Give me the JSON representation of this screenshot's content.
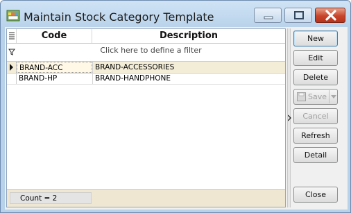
{
  "window": {
    "title": "Maintain Stock Category Template"
  },
  "grid": {
    "columns": [
      {
        "label": "Code"
      },
      {
        "label": "Description"
      }
    ],
    "filter_hint": "Click here to define a filter",
    "rows": [
      {
        "code": "BRAND-ACC",
        "description": "BRAND-ACCESSORIES",
        "selected": true
      },
      {
        "code": "BRAND-HP",
        "description": "BRAND-HANDPHONE",
        "selected": false
      }
    ],
    "footer": {
      "count_text": "Count = 2"
    }
  },
  "buttons": {
    "new": "New",
    "edit": "Edit",
    "delete": "Delete",
    "save": "Save",
    "cancel": "Cancel",
    "refresh": "Refresh",
    "detail": "Detail",
    "close": "Close"
  },
  "colors": {
    "selected_row": "#f3edd8",
    "footer": "#efe7d2",
    "close_button": "#c7452b"
  }
}
